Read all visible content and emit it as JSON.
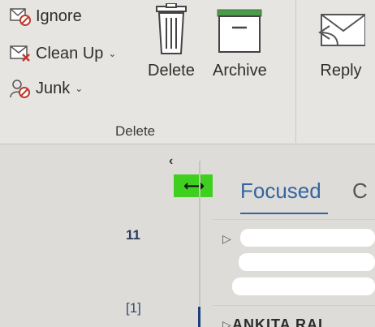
{
  "ribbon": {
    "ignore_label": "Ignore",
    "cleanup_label": "Clean Up",
    "junk_label": "Junk",
    "delete_label": "Delete",
    "archive_label": "Archive",
    "reply_label": "Reply",
    "group_label": "Delete"
  },
  "folders": {
    "collapse_glyph": "‹",
    "resize_glyph": "⟷",
    "counts": [
      "11",
      "[1]"
    ]
  },
  "mail": {
    "tabs": [
      "Focused",
      "C"
    ],
    "bottom_sender": "ANKITA RAI"
  },
  "colors": {
    "accent": "#3565a0",
    "handle": "#3fcf1f",
    "archive_green": "#4c9a4c"
  }
}
